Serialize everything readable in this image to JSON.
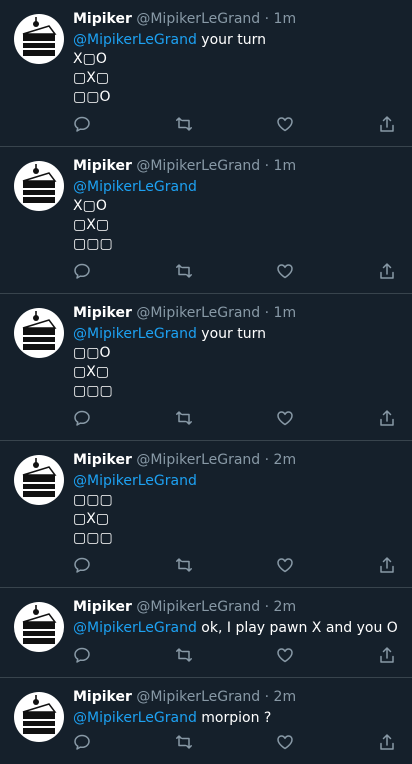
{
  "tweets": [
    {
      "name": "Mipiker",
      "handle": "@MipikerLeGrand",
      "dot": "·",
      "time": "1m",
      "mention": "@MipikerLeGrand",
      "text": "your turn",
      "lines": [
        "X▢O",
        "▢X▢",
        "▢▢O"
      ]
    },
    {
      "name": "Mipiker",
      "handle": "@MipikerLeGrand",
      "dot": "·",
      "time": "1m",
      "mention": "@MipikerLeGrand",
      "text": "",
      "lines": [
        "X▢O",
        "▢X▢",
        "▢▢▢"
      ]
    },
    {
      "name": "Mipiker",
      "handle": "@MipikerLeGrand",
      "dot": "·",
      "time": "1m",
      "mention": "@MipikerLeGrand",
      "text": "your turn",
      "lines": [
        "▢▢O",
        "▢X▢",
        "▢▢▢"
      ]
    },
    {
      "name": "Mipiker",
      "handle": "@MipikerLeGrand",
      "dot": "·",
      "time": "2m",
      "mention": "@MipikerLeGrand",
      "text": "",
      "lines": [
        "▢▢▢",
        "▢X▢",
        "▢▢▢"
      ]
    },
    {
      "name": "Mipiker",
      "handle": "@MipikerLeGrand",
      "dot": "·",
      "time": "2m",
      "mention": "@MipikerLeGrand",
      "text": "ok, I play pawn X and you O",
      "lines": []
    },
    {
      "name": "Mipiker",
      "handle": "@MipikerLeGrand",
      "dot": "·",
      "time": "2m",
      "mention": "@MipikerLeGrand",
      "text": "morpion ?",
      "lines": []
    }
  ],
  "icons": {
    "reply": "reply-icon",
    "retweet": "retweet-icon",
    "like": "like-icon",
    "share": "share-icon"
  },
  "colors": {
    "background": "#15202b",
    "divider": "#38444d",
    "secondary_text": "#8899a6",
    "link": "#1da1f2"
  }
}
